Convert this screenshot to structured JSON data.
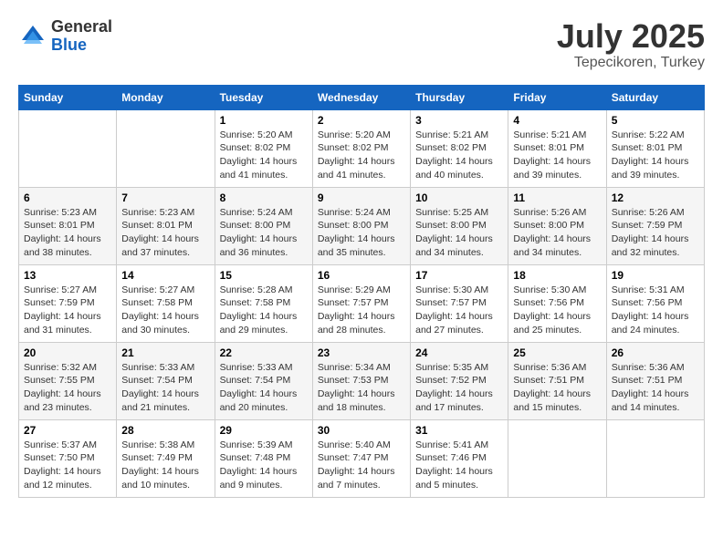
{
  "logo": {
    "general": "General",
    "blue": "Blue"
  },
  "title": {
    "month_year": "July 2025",
    "location": "Tepecikoren, Turkey"
  },
  "headers": [
    "Sunday",
    "Monday",
    "Tuesday",
    "Wednesday",
    "Thursday",
    "Friday",
    "Saturday"
  ],
  "weeks": [
    [
      {
        "day": "",
        "info": ""
      },
      {
        "day": "",
        "info": ""
      },
      {
        "day": "1",
        "info": "Sunrise: 5:20 AM\nSunset: 8:02 PM\nDaylight: 14 hours and 41 minutes."
      },
      {
        "day": "2",
        "info": "Sunrise: 5:20 AM\nSunset: 8:02 PM\nDaylight: 14 hours and 41 minutes."
      },
      {
        "day": "3",
        "info": "Sunrise: 5:21 AM\nSunset: 8:02 PM\nDaylight: 14 hours and 40 minutes."
      },
      {
        "day": "4",
        "info": "Sunrise: 5:21 AM\nSunset: 8:01 PM\nDaylight: 14 hours and 39 minutes."
      },
      {
        "day": "5",
        "info": "Sunrise: 5:22 AM\nSunset: 8:01 PM\nDaylight: 14 hours and 39 minutes."
      }
    ],
    [
      {
        "day": "6",
        "info": "Sunrise: 5:23 AM\nSunset: 8:01 PM\nDaylight: 14 hours and 38 minutes."
      },
      {
        "day": "7",
        "info": "Sunrise: 5:23 AM\nSunset: 8:01 PM\nDaylight: 14 hours and 37 minutes."
      },
      {
        "day": "8",
        "info": "Sunrise: 5:24 AM\nSunset: 8:00 PM\nDaylight: 14 hours and 36 minutes."
      },
      {
        "day": "9",
        "info": "Sunrise: 5:24 AM\nSunset: 8:00 PM\nDaylight: 14 hours and 35 minutes."
      },
      {
        "day": "10",
        "info": "Sunrise: 5:25 AM\nSunset: 8:00 PM\nDaylight: 14 hours and 34 minutes."
      },
      {
        "day": "11",
        "info": "Sunrise: 5:26 AM\nSunset: 8:00 PM\nDaylight: 14 hours and 34 minutes."
      },
      {
        "day": "12",
        "info": "Sunrise: 5:26 AM\nSunset: 7:59 PM\nDaylight: 14 hours and 32 minutes."
      }
    ],
    [
      {
        "day": "13",
        "info": "Sunrise: 5:27 AM\nSunset: 7:59 PM\nDaylight: 14 hours and 31 minutes."
      },
      {
        "day": "14",
        "info": "Sunrise: 5:27 AM\nSunset: 7:58 PM\nDaylight: 14 hours and 30 minutes."
      },
      {
        "day": "15",
        "info": "Sunrise: 5:28 AM\nSunset: 7:58 PM\nDaylight: 14 hours and 29 minutes."
      },
      {
        "day": "16",
        "info": "Sunrise: 5:29 AM\nSunset: 7:57 PM\nDaylight: 14 hours and 28 minutes."
      },
      {
        "day": "17",
        "info": "Sunrise: 5:30 AM\nSunset: 7:57 PM\nDaylight: 14 hours and 27 minutes."
      },
      {
        "day": "18",
        "info": "Sunrise: 5:30 AM\nSunset: 7:56 PM\nDaylight: 14 hours and 25 minutes."
      },
      {
        "day": "19",
        "info": "Sunrise: 5:31 AM\nSunset: 7:56 PM\nDaylight: 14 hours and 24 minutes."
      }
    ],
    [
      {
        "day": "20",
        "info": "Sunrise: 5:32 AM\nSunset: 7:55 PM\nDaylight: 14 hours and 23 minutes."
      },
      {
        "day": "21",
        "info": "Sunrise: 5:33 AM\nSunset: 7:54 PM\nDaylight: 14 hours and 21 minutes."
      },
      {
        "day": "22",
        "info": "Sunrise: 5:33 AM\nSunset: 7:54 PM\nDaylight: 14 hours and 20 minutes."
      },
      {
        "day": "23",
        "info": "Sunrise: 5:34 AM\nSunset: 7:53 PM\nDaylight: 14 hours and 18 minutes."
      },
      {
        "day": "24",
        "info": "Sunrise: 5:35 AM\nSunset: 7:52 PM\nDaylight: 14 hours and 17 minutes."
      },
      {
        "day": "25",
        "info": "Sunrise: 5:36 AM\nSunset: 7:51 PM\nDaylight: 14 hours and 15 minutes."
      },
      {
        "day": "26",
        "info": "Sunrise: 5:36 AM\nSunset: 7:51 PM\nDaylight: 14 hours and 14 minutes."
      }
    ],
    [
      {
        "day": "27",
        "info": "Sunrise: 5:37 AM\nSunset: 7:50 PM\nDaylight: 14 hours and 12 minutes."
      },
      {
        "day": "28",
        "info": "Sunrise: 5:38 AM\nSunset: 7:49 PM\nDaylight: 14 hours and 10 minutes."
      },
      {
        "day": "29",
        "info": "Sunrise: 5:39 AM\nSunset: 7:48 PM\nDaylight: 14 hours and 9 minutes."
      },
      {
        "day": "30",
        "info": "Sunrise: 5:40 AM\nSunset: 7:47 PM\nDaylight: 14 hours and 7 minutes."
      },
      {
        "day": "31",
        "info": "Sunrise: 5:41 AM\nSunset: 7:46 PM\nDaylight: 14 hours and 5 minutes."
      },
      {
        "day": "",
        "info": ""
      },
      {
        "day": "",
        "info": ""
      }
    ]
  ]
}
